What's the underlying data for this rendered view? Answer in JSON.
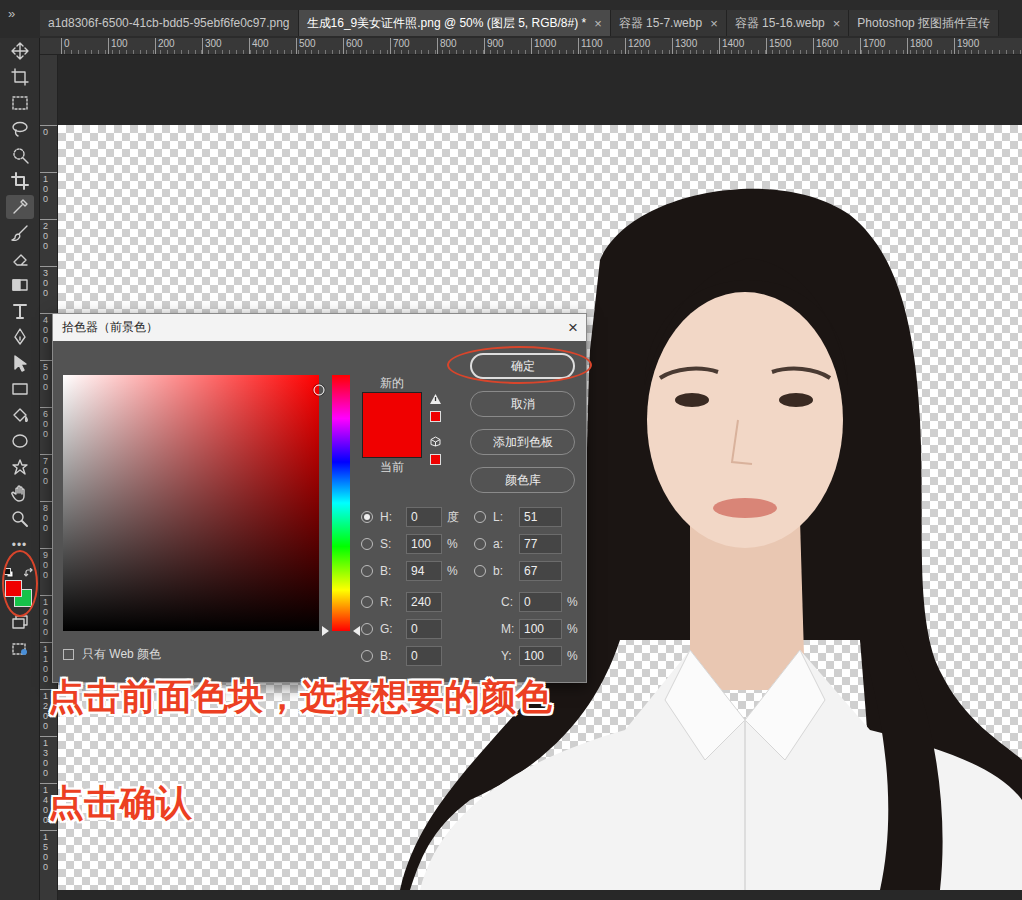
{
  "tabs_overflow": "»",
  "tabs": [
    {
      "label": "a1d8306f-6500-41cb-bdd5-95ebf6fe0c97.png",
      "selected": false
    },
    {
      "label": "生成16_9美女证件照.png @ 50% (图层 5, RGB/8#) *",
      "selected": true,
      "close": "×"
    },
    {
      "label": "容器 15-7.webp",
      "selected": false,
      "close": "×"
    },
    {
      "label": "容器 15-16.webp",
      "selected": false,
      "close": "×"
    },
    {
      "label": "Photoshop 抠图插件宣传",
      "selected": false
    }
  ],
  "rulers": {
    "horizontal": [
      "0",
      "100",
      "200",
      "300",
      "400",
      "500",
      "600",
      "700",
      "800",
      "900",
      "1000",
      "1100",
      "1200",
      "1300",
      "1400",
      "1500",
      "1600",
      "1700",
      "1800",
      "1900"
    ],
    "vertical": [
      "0",
      "100",
      "200",
      "300",
      "400",
      "500",
      "600",
      "700",
      "800",
      "900",
      "1000",
      "1100",
      "1200",
      "1300",
      "1400",
      "1500"
    ]
  },
  "toolbar": {
    "tools": [
      {
        "kind": "move",
        "selected": false
      },
      {
        "kind": "artboard",
        "selected": false
      },
      {
        "kind": "marquee",
        "selected": false
      },
      {
        "kind": "lasso",
        "selected": false
      },
      {
        "kind": "quickselect",
        "selected": false
      },
      {
        "kind": "crop",
        "selected": false
      },
      {
        "kind": "eyedropper",
        "selected": true
      },
      {
        "kind": "brush",
        "selected": false
      },
      {
        "kind": "eraser",
        "selected": false
      },
      {
        "kind": "gradient",
        "selected": false
      },
      {
        "kind": "type",
        "selected": false
      },
      {
        "kind": "pen",
        "selected": false
      },
      {
        "kind": "pathselect",
        "selected": false
      },
      {
        "kind": "rectangle",
        "selected": false
      },
      {
        "kind": "bucket",
        "selected": false
      },
      {
        "kind": "ellipse",
        "selected": false
      },
      {
        "kind": "shape",
        "selected": false
      },
      {
        "kind": "hand",
        "selected": false
      },
      {
        "kind": "zoom",
        "selected": false
      }
    ],
    "more": "•••",
    "foreground": "#f00000",
    "background": "#16c24a",
    "bottom_tools": [
      {
        "kind": "screenmode"
      },
      {
        "kind": "quickmask"
      }
    ]
  },
  "dialog": {
    "title": "拾色器（前景色）",
    "close": "×",
    "picker": {
      "saturation_level": 1,
      "brightness_level": 0.94
    },
    "hue_level": 0,
    "new_label": "新的",
    "current_label": "当前",
    "new_color": "#f00000",
    "current_color": "#f00000",
    "buttons": [
      {
        "label": "确定",
        "default": true
      },
      {
        "label": "取消",
        "default": false
      },
      {
        "label": "添加到色板",
        "default": false
      },
      {
        "label": "颜色库",
        "default": false
      }
    ],
    "fields_left": [
      {
        "kind": "radio",
        "label": "H:",
        "value": "0",
        "unit": "度",
        "selected": true
      },
      {
        "kind": "radio",
        "label": "S:",
        "value": "100",
        "unit": "%",
        "selected": false
      },
      {
        "kind": "radio",
        "label": "B:",
        "value": "94",
        "unit": "%",
        "selected": false
      },
      {
        "kind": "radio",
        "label": "R:",
        "value": "240",
        "unit": "",
        "selected": false
      },
      {
        "kind": "radio",
        "label": "G:",
        "value": "0",
        "unit": "",
        "selected": false
      },
      {
        "kind": "radio",
        "label": "B:",
        "value": "0",
        "unit": "",
        "selected": false
      }
    ],
    "fields_right": [
      {
        "kind": "radio",
        "label": "L:",
        "value": "51",
        "unit": "",
        "selected": false
      },
      {
        "kind": "radio",
        "label": "a:",
        "value": "77",
        "unit": "",
        "selected": false
      },
      {
        "kind": "radio",
        "label": "b:",
        "value": "67",
        "unit": "",
        "selected": false
      },
      {
        "kind": "plain",
        "label": "C:",
        "value": "0",
        "unit": "%"
      },
      {
        "kind": "plain",
        "label": "M:",
        "value": "100",
        "unit": "%"
      },
      {
        "kind": "plain",
        "label": "Y:",
        "value": "100",
        "unit": "%"
      }
    ],
    "web_only": {
      "label": "只有 Web 颜色",
      "checked": false
    }
  },
  "annotations": [
    {
      "text": "点击前面色块，选择想要的颜色"
    },
    {
      "text": "点击确认"
    }
  ]
}
